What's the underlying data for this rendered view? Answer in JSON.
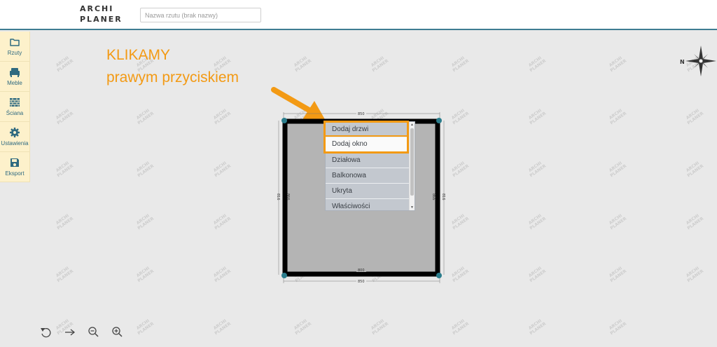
{
  "app": {
    "logo_line1": "ARCHI",
    "logo_line2": "PLANER",
    "plan_name_placeholder": "Nazwa rzutu (brak nazwy)",
    "plan_name_value": ""
  },
  "sidebar": {
    "items": [
      {
        "label": "Rzuty",
        "icon": "folder-icon"
      },
      {
        "label": "Meble",
        "icon": "armchair-icon"
      },
      {
        "label": "Ściana",
        "icon": "brick-wall-icon"
      },
      {
        "label": "Ustawienia",
        "icon": "gear-icon"
      },
      {
        "label": "Eksport",
        "icon": "save-disk-icon"
      }
    ]
  },
  "watermark": {
    "line1": "ARCHI",
    "line2": "PLANER"
  },
  "annotation": {
    "title": "KLIKAMY",
    "subtitle": "prawym przyciskiem",
    "color": "#f39a14"
  },
  "compass": {
    "north_label": "N"
  },
  "room": {
    "dim_top": "850",
    "dim_bottom_outer": "850",
    "dim_bottom_inner": "800",
    "dim_left_outer": "816",
    "dim_left_inner": "866",
    "dim_right_outer": "816",
    "dim_right_inner": "866"
  },
  "context_menu": {
    "items": [
      {
        "label": "Dodaj drzwi"
      },
      {
        "label": "Dodaj okno"
      },
      {
        "label": "Działowa"
      },
      {
        "label": "Balkonowa"
      },
      {
        "label": "Ukryta"
      },
      {
        "label": "Właściwości"
      }
    ]
  },
  "toolbar": {
    "undo": "undo-icon",
    "redo": "redo-arrow-icon",
    "zoom_out": "zoom-out-icon",
    "zoom_in": "zoom-in-icon"
  },
  "colors": {
    "accent": "#3e7d92",
    "sidebar_bg": "#fdf1cb",
    "highlight": "#f39a14",
    "wall": "#000000",
    "floor": "#b4b4b4",
    "corner": "#2b7d8c"
  }
}
